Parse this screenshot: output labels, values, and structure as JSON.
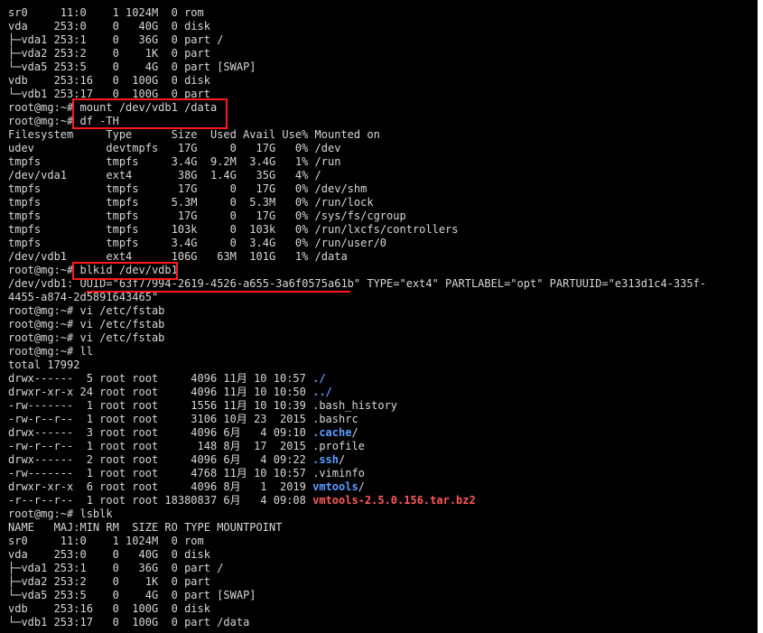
{
  "terminal": {
    "lines": [
      [
        {
          "t": "sr0     11:0    1 1024M  0 rom"
        }
      ],
      [
        {
          "t": "vda    253:0    0   40G  0 disk"
        }
      ],
      [
        {
          "t": "├─vda1 253:1    0   36G  0 part /"
        }
      ],
      [
        {
          "t": "├─vda2 253:2    0    1K  0 part"
        }
      ],
      [
        {
          "t": "└─vda5 253:5    0    4G  0 part [SWAP]"
        }
      ],
      [
        {
          "t": "vdb    253:16   0  100G  0 disk"
        }
      ],
      [
        {
          "t": "└─vdb1 253:17   0  100G  0 part"
        }
      ],
      [
        {
          "t": "root@mg:~# mount /dev/vdb1 /data"
        }
      ],
      [
        {
          "t": "root@mg:~# df -TH"
        }
      ],
      [
        {
          "t": "Filesystem     Type      Size  Used Avail Use% Mounted on"
        }
      ],
      [
        {
          "t": "udev           devtmpfs   17G     0   17G   0% /dev"
        }
      ],
      [
        {
          "t": "tmpfs          tmpfs     3.4G  9.2M  3.4G   1% /run"
        }
      ],
      [
        {
          "t": "/dev/vda1      ext4       38G  1.4G   35G   4% /"
        }
      ],
      [
        {
          "t": "tmpfs          tmpfs      17G     0   17G   0% /dev/shm"
        }
      ],
      [
        {
          "t": "tmpfs          tmpfs     5.3M     0  5.3M   0% /run/lock"
        }
      ],
      [
        {
          "t": "tmpfs          tmpfs      17G     0   17G   0% /sys/fs/cgroup"
        }
      ],
      [
        {
          "t": "tmpfs          tmpfs     103k     0  103k   0% /run/lxcfs/controllers"
        }
      ],
      [
        {
          "t": "tmpfs          tmpfs     3.4G     0  3.4G   0% /run/user/0"
        }
      ],
      [
        {
          "t": "/dev/vdb1      ext4      106G   63M  101G   1% /data"
        }
      ],
      [
        {
          "t": "root@mg:~# blkid /dev/vdb1"
        }
      ],
      [
        {
          "t": "/dev/vdb1: UUID=\"63f77994-2619-4526-a655-3a6f0575a61b\" TYPE=\"ext4\" PARTLABEL=\"opt\" PARTUUID=\"e313d1c4-335f-"
        }
      ],
      [
        {
          "t": "4455-a874-2d5891643465\""
        }
      ],
      [
        {
          "t": "root@mg:~# vi /etc/fstab"
        }
      ],
      [
        {
          "t": "root@mg:~# vi /etc/fstab"
        }
      ],
      [
        {
          "t": "root@mg:~# vi /etc/fstab"
        }
      ],
      [
        {
          "t": "root@mg:~# ll"
        }
      ],
      [
        {
          "t": "total 17992"
        }
      ],
      [
        {
          "t": "drwx------  5 root root     4096 11月 10 10:57 "
        },
        {
          "t": "./",
          "c": "blue"
        }
      ],
      [
        {
          "t": "drwxr-xr-x 24 root root     4096 11月 10 10:50 "
        },
        {
          "t": "../",
          "c": "blue"
        }
      ],
      [
        {
          "t": "-rw-------  1 root root     1556 11月 10 10:39 .bash_history"
        }
      ],
      [
        {
          "t": "-rw-r--r--  1 root root     3106 10月 23  2015 .bashrc"
        }
      ],
      [
        {
          "t": "drwx------  3 root root     4096 6月   4 09:10 "
        },
        {
          "t": ".cache",
          "c": "blue"
        },
        {
          "t": "/"
        }
      ],
      [
        {
          "t": "-rw-r--r--  1 root root      148 8月  17  2015 .profile"
        }
      ],
      [
        {
          "t": "drwx------  2 root root     4096 6月   4 09:22 "
        },
        {
          "t": ".ssh",
          "c": "blue"
        },
        {
          "t": "/"
        }
      ],
      [
        {
          "t": "-rw-------  1 root root     4768 11月 10 10:57 .viminfo"
        }
      ],
      [
        {
          "t": "drwxr-xr-x  6 root root     4096 8月   1  2019 "
        },
        {
          "t": "vmtools",
          "c": "blue"
        },
        {
          "t": "/"
        }
      ],
      [
        {
          "t": "-r--r--r--  1 root root 18380837 6月   4 09:08 "
        },
        {
          "t": "vmtools-2.5.0.156.tar.bz2",
          "c": "red"
        }
      ],
      [
        {
          "t": "root@mg:~# lsblk"
        }
      ],
      [
        {
          "t": "NAME   MAJ:MIN RM  SIZE RO TYPE MOUNTPOINT"
        }
      ],
      [
        {
          "t": "sr0     11:0    1 1024M  0 rom"
        }
      ],
      [
        {
          "t": "vda    253:0    0   40G  0 disk"
        }
      ],
      [
        {
          "t": "├─vda1 253:1    0   36G  0 part /"
        }
      ],
      [
        {
          "t": "├─vda2 253:2    0    1K  0 part"
        }
      ],
      [
        {
          "t": "└─vda5 253:5    0    4G  0 part [SWAP]"
        }
      ],
      [
        {
          "t": "vdb    253:16   0  100G  0 disk"
        }
      ],
      [
        {
          "t": "└─vdb1 253:17   0  100G  0 part /data"
        }
      ]
    ],
    "colors": {
      "background": "#000000",
      "foreground": "#d8d8d8",
      "directory": "#5c9cff",
      "archive": "#ff5a5a",
      "highlight": "#ff1a1a"
    }
  }
}
